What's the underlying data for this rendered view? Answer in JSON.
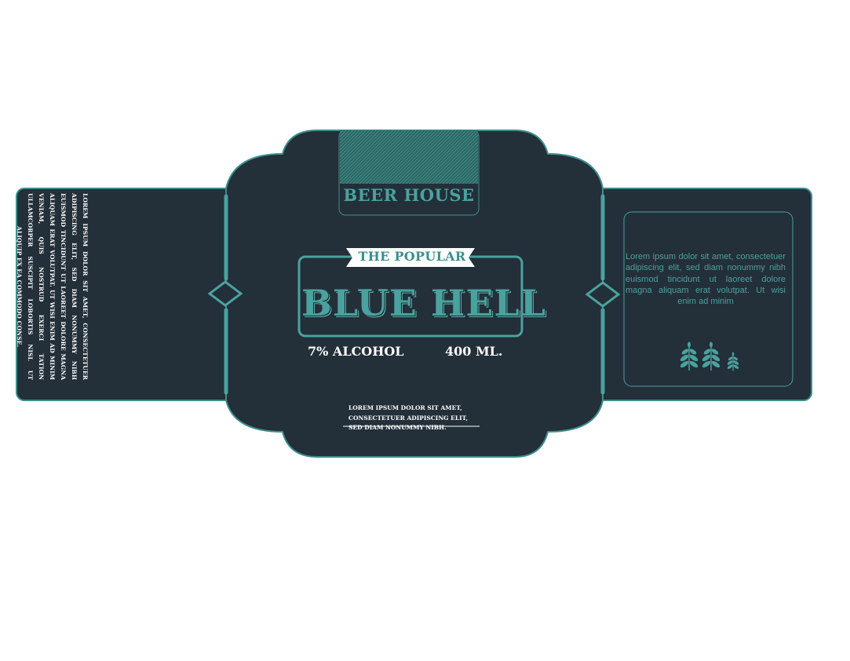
{
  "label": {
    "brand": "BEER HOUSE",
    "tagline": "THE POPULAR",
    "product_name": "BLUE HELL",
    "alcohol": "7% ALCOHOL",
    "volume": "400 ML.",
    "center_footer": "LOREM IPSUM DOLOR SIT AMET, CONSECTETUER ADIPISCING ELIT, SED DIAM NONUMMY NIBH.",
    "left_panel_text": "LOREM IPSUM DOLOR SIT AMET, CONSECTETUER ADIPISCING ELIT, SED DIAM NONUMMY NIBH EUISMOD TINCIDUNT UT LAOREET DOLORE MAGNA ALIQUAM ERAT VOLUTPAT. UT WISI ENIM AD MINIM VENIAM, QUIS NOSTRUD EXERCI TATION ULLAMCORPER SUSCIPIT LOBORTIS NISL UT ALIQUIP EX EA COMMODO CONSE.",
    "right_panel_text": "Lorem ipsum dolor sit amet, consectetuer adipiscing elit, sed diam nonummy nibh euismod tincidunt ut laoreet dolore magna aliquam erat volutpat. Ut wisi enim ad minim"
  },
  "colors": {
    "panel_background": "#232f39",
    "accent_teal": "#4aa29e",
    "border_teal": "#3c8f8c",
    "text_white": "#ffffff",
    "page_background": "#ffffff"
  },
  "icons": [
    "wheat-leaf-icon",
    "wheat-leaf-icon",
    "wheat-leaf-icon",
    "diamond-ornament-icon",
    "diamond-ornament-icon"
  ]
}
